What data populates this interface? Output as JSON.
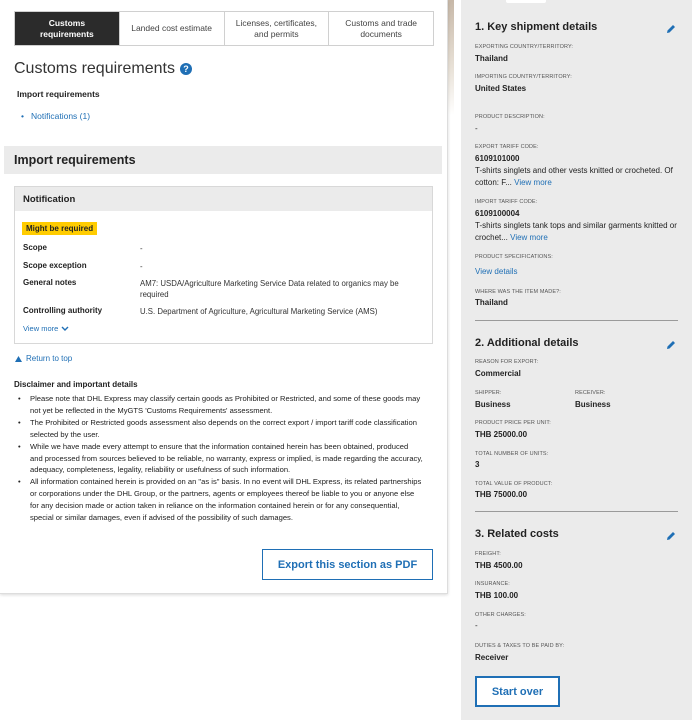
{
  "tabs": [
    {
      "label": "Customs requirements",
      "active": true
    },
    {
      "label": "Landed cost estimate",
      "active": false
    },
    {
      "label": "Licenses, certificates, and permits",
      "active": false
    },
    {
      "label": "Customs and trade documents",
      "active": false
    }
  ],
  "page_title": "Customs requirements",
  "import_requirements_heading": "Import requirements",
  "notifications_link": "Notifications (1)",
  "section_title": "Import requirements",
  "notification": {
    "heading": "Notification",
    "badge": "Might be required",
    "scope_label": "Scope",
    "scope_value": "-",
    "scope_exception_label": "Scope exception",
    "scope_exception_value": "-",
    "general_notes_label": "General notes",
    "general_notes_value": "AM7: USDA/Agriculture Marketing Service Data related to organics may be required",
    "controlling_authority_label": "Controlling authority",
    "controlling_authority_value": "U.S. Department of Agriculture, Agricultural Marketing Service (AMS)",
    "view_more": "View more"
  },
  "return_to_top": "Return to top",
  "disclaimer": {
    "title": "Disclaimer and important details",
    "items": [
      "Please note that DHL Express may classify certain goods as Prohibited or Restricted, and some of these goods may not yet be reflected in the MyGTS 'Customs Requirements' assessment.",
      "The Prohibited or Restricted goods assessment also depends on the correct export / import tariff code classification selected by the user.",
      "While we have made every attempt to ensure that the information contained herein has been obtained, produced and processed from sources believed to be reliable, no warranty, express or implied, is made regarding the accuracy, adequacy, completeness, legality, reliability or usefulness of such information.",
      "All information contained herein is provided on an \"as is\" basis. In no event will DHL Express, its related partnerships or corporations under the DHL Group, or the partners, agents or employees thereof be liable to you or anyone else for any decision made or action taken in reliance on the information contained herein or for any consequential, special or similar damages, even if advised of the possibility of such damages."
    ]
  },
  "export_pdf_button": "Export this section as PDF",
  "summary": {
    "key_details": {
      "title": "1. Key shipment details",
      "exporting_label": "EXPORTING COUNTRY/TERRITORY:",
      "exporting_value": "Thailand",
      "importing_label": "IMPORTING COUNTRY/TERRITORY:",
      "importing_value": "United States",
      "product_desc_label": "PRODUCT DESCRIPTION:",
      "product_desc_value": "-",
      "export_tariff_label": "EXPORT TARIFF CODE:",
      "export_tariff_code": "6109101000",
      "export_tariff_desc": "T-shirts singlets and other vests knitted or crocheted. Of cotton: F...",
      "export_view_more": "View more",
      "import_tariff_label": "IMPORT TARIFF CODE:",
      "import_tariff_code": "6109100004",
      "import_tariff_desc": "T-shirts singlets tank tops and similar garments knitted or crochet...",
      "import_view_more": "View more",
      "product_spec_label": "PRODUCT SPECIFICATIONS:",
      "product_spec_link": "View details",
      "made_label": "WHERE WAS THE ITEM MADE?:",
      "made_value": "Thailand"
    },
    "additional": {
      "title": "2. Additional details",
      "reason_label": "REASON FOR EXPORT:",
      "reason_value": "Commercial",
      "shipper_label": "SHIPPER:",
      "shipper_value": "Business",
      "receiver_label": "RECEIVER:",
      "receiver_value": "Business",
      "price_label": "PRODUCT PRICE PER UNIT:",
      "price_value": "THB 25000.00",
      "units_label": "TOTAL NUMBER OF UNITS:",
      "units_value": "3",
      "total_label": "TOTAL VALUE OF PRODUCT:",
      "total_value": "THB 75000.00"
    },
    "costs": {
      "title": "3. Related costs",
      "freight_label": "FREIGHT:",
      "freight_value": "THB 4500.00",
      "insurance_label": "INSURANCE:",
      "insurance_value": "THB 100.00",
      "other_label": "OTHER CHARGES:",
      "other_value": "-",
      "duties_label": "DUTIES & TAXES TO BE PAID BY:",
      "duties_value": "Receiver"
    },
    "start_over_button": "Start over"
  },
  "colors": {
    "accent": "#1f6fb5",
    "badge": "#ffcc00",
    "active_tab": "#2b2b2b",
    "panel_bg": "#ebebeb"
  },
  "icons": {
    "help": "question-circle-icon",
    "edit": "pencil-icon",
    "return": "triangle-up-icon",
    "expand": "chevron-down-icon"
  }
}
